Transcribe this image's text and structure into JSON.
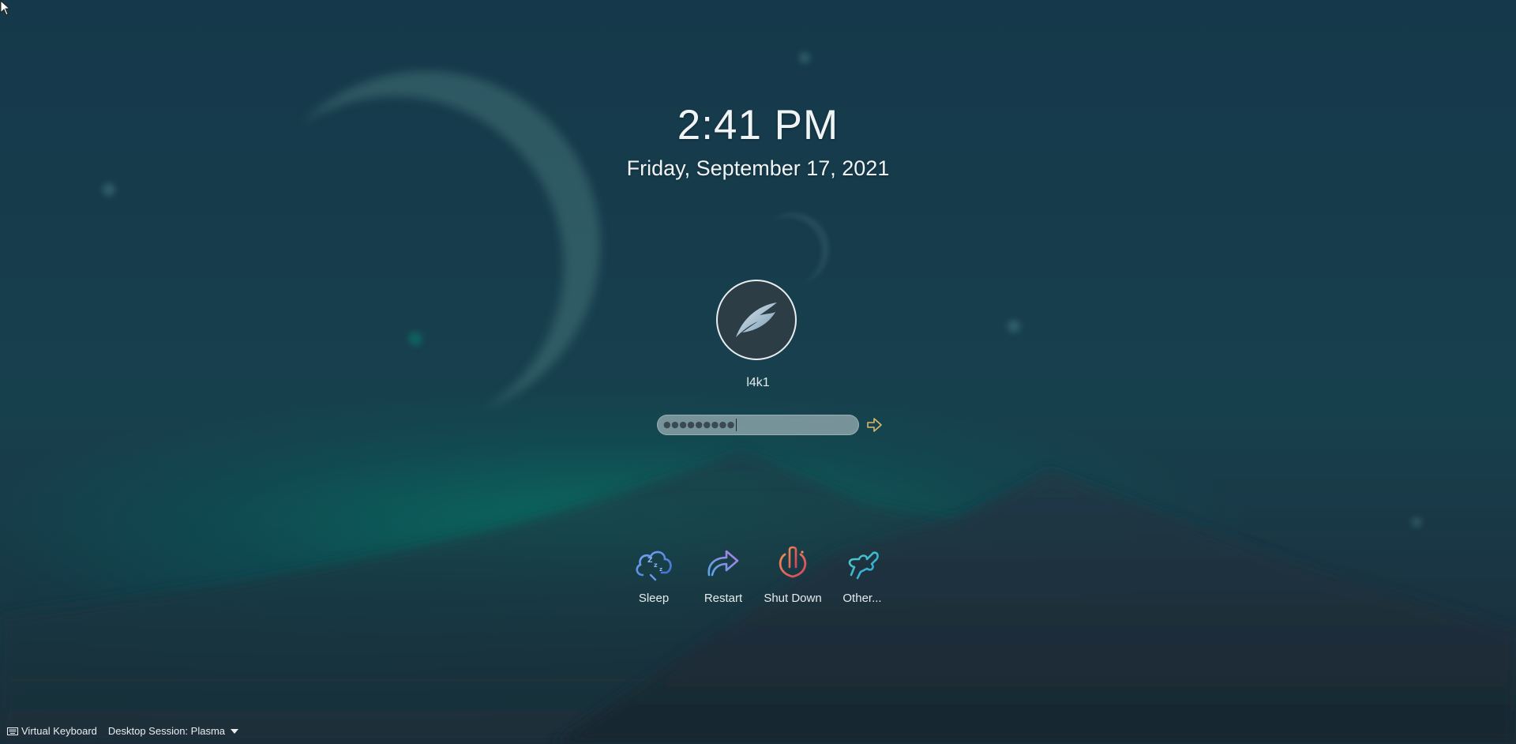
{
  "clock": {
    "time": "2:41 PM",
    "date": "Friday, September 17, 2021"
  },
  "user": {
    "name": "l4k1",
    "avatar_icon": "feather-logo-icon"
  },
  "password": {
    "masked_value": "●●●●●●●●●"
  },
  "login_button": {
    "icon": "arrow-right-icon"
  },
  "actions": [
    {
      "label": "Sleep",
      "icon": "sleep-icon"
    },
    {
      "label": "Restart",
      "icon": "restart-icon"
    },
    {
      "label": "Shut Down",
      "icon": "shutdown-icon"
    },
    {
      "label": "Other...",
      "icon": "switch-user-icon"
    }
  ],
  "bottom_bar": {
    "virtual_keyboard": "Virtual Keyboard",
    "session": "Desktop Session: Plasma"
  },
  "colors": {
    "background": "#17323f",
    "accent_teal": "#00a58c",
    "shutdown_red": "#e8604a",
    "restart_blue": "#5b8fe8"
  }
}
